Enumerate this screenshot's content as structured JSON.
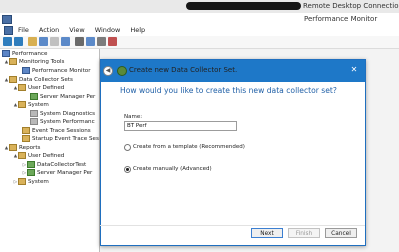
{
  "rdp": {
    "title": "Remote Desktop Connection"
  },
  "app": {
    "title": "Performance Monitor"
  },
  "menu": [
    "File",
    "Action",
    "View",
    "Window",
    "Help"
  ],
  "tree": {
    "root": "Performance",
    "items": [
      {
        "label": "Monitoring Tools",
        "toggle": "▲"
      },
      {
        "label": "Performance Monitor",
        "toggle": ""
      },
      {
        "label": "Data Collector Sets",
        "toggle": "▲"
      },
      {
        "label": "User Defined",
        "toggle": "▲"
      },
      {
        "label": "Server Manager Per",
        "toggle": ""
      },
      {
        "label": "System",
        "toggle": "▲"
      },
      {
        "label": "System Diagnostics",
        "toggle": ""
      },
      {
        "label": "System Performanc",
        "toggle": ""
      },
      {
        "label": "Event Trace Sessions",
        "toggle": ""
      },
      {
        "label": "Startup Event Trace Ses",
        "toggle": ""
      },
      {
        "label": "Reports",
        "toggle": "▲"
      },
      {
        "label": "User Defined",
        "toggle": "▲"
      },
      {
        "label": "DataCollectorTest",
        "toggle": "▷"
      },
      {
        "label": "Server Manager Per",
        "toggle": "▷"
      },
      {
        "label": "System",
        "toggle": "▷"
      }
    ]
  },
  "dialog": {
    "close_glyph": "✕",
    "back_glyph": "◀",
    "heading": "Create new Data Collector Set.",
    "question": "How would you like to create this new data collector set?",
    "name_label": "Name:",
    "name_value": "BT Perf",
    "option_template": "Create from a template (Recommended)",
    "option_manual": "Create manually (Advanced)",
    "buttons": {
      "next": "Next",
      "finish": "Finish",
      "cancel": "Cancel"
    }
  },
  "colors": {
    "dialog_titlebar": "#1e78c8",
    "question_text": "#1f5fa6",
    "primary_button_border": "#3c7fd1"
  }
}
